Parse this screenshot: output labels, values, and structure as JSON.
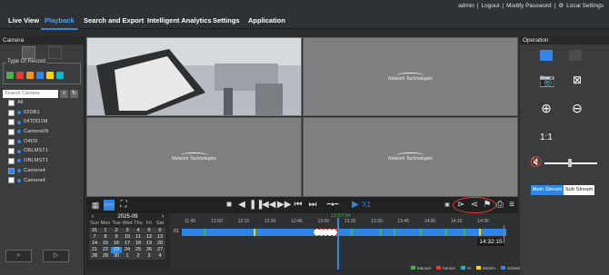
{
  "header": {
    "user": "admin",
    "logout": "Logout",
    "modify_password": "Modify Password",
    "local_settings": "Local Settings",
    "nav": [
      "Live View",
      "Playback",
      "Search and Export",
      "Intelligent Analytics",
      "Settings",
      "Application"
    ],
    "active_nav": "Playback"
  },
  "left_panel": {
    "title": "Camera",
    "type_of_record": "Type Of Record",
    "record_colors": [
      "#4caf50",
      "#e53935",
      "#ff9800",
      "#2e86e6",
      "#ffd600",
      "#00bcd4"
    ],
    "search_placeholder": "Search Camera",
    "cameras": [
      {
        "name": "All",
        "checked": false,
        "dot": false
      },
      {
        "name": "02DB1",
        "checked": false,
        "dot": true
      },
      {
        "name": "04TDD1M",
        "checked": false,
        "dot": true
      },
      {
        "name": "Camera09",
        "checked": false,
        "dot": true
      },
      {
        "name": "O4D9",
        "checked": false,
        "dot": true
      },
      {
        "name": "OBLMST1",
        "checked": false,
        "dot": true
      },
      {
        "name": "OBLMST1",
        "checked": false,
        "dot": true
      },
      {
        "name": "Camera4",
        "checked": true,
        "dot": true
      },
      {
        "name": "Camera4",
        "checked": false,
        "dot": true
      }
    ]
  },
  "video": {
    "watermark": "Network Technologies"
  },
  "toolbar": {
    "speed": "X1",
    "current_time_top": "13:07:34"
  },
  "calendar": {
    "month": "2025-09",
    "weekdays": [
      "Sun",
      "Mon",
      "Tue",
      "Wed",
      "Thu",
      "Fri",
      "Sat"
    ],
    "days": [
      "31",
      "1",
      "2",
      "3",
      "4",
      "5",
      "6",
      "7",
      "8",
      "9",
      "10",
      "11",
      "12",
      "13",
      "14",
      "15",
      "16",
      "17",
      "18",
      "19",
      "20",
      "21",
      "22",
      "23",
      "24",
      "25",
      "26",
      "27",
      "28",
      "29",
      "30",
      "1",
      "2",
      "3",
      "4"
    ],
    "selected": "23"
  },
  "timeline": {
    "ticks": [
      "11:45",
      "12:00",
      "12:15",
      "12:30",
      "12:45",
      "13:00",
      "13:15",
      "13:30",
      "13:45",
      "14:00",
      "14:15",
      "14:30"
    ],
    "row_label": "01",
    "time_badge": "14:32:15"
  },
  "legend": [
    {
      "label": "Manual",
      "color": "#4caf50"
    },
    {
      "label": "Sensor",
      "color": "#e53935"
    },
    {
      "label": "AI",
      "color": "#00bcd4"
    },
    {
      "label": "Motion",
      "color": "#ffd600"
    },
    {
      "label": "Schedule",
      "color": "#2e86e6"
    }
  ],
  "right_panel": {
    "title": "Operation",
    "main_stream": "Main Stream",
    "sub_stream": "Sub Stream",
    "ratio_label": "1:1"
  }
}
